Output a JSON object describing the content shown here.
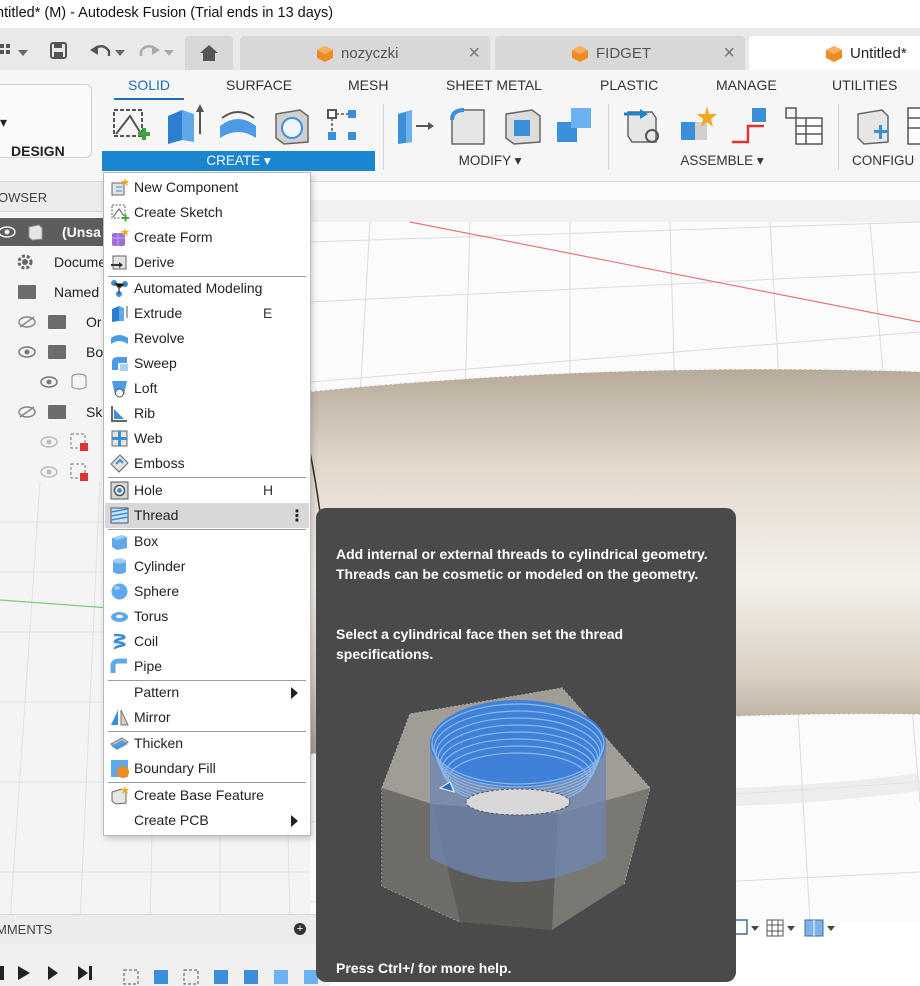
{
  "window": {
    "title": "ntitled* (M) - Autodesk Fusion (Trial ends in 13 days)"
  },
  "tabs": [
    {
      "label": "nozyczki",
      "active": false
    },
    {
      "label": "FIDGET",
      "active": false
    },
    {
      "label": "Untitled*",
      "active": true
    }
  ],
  "ribbon": {
    "workspace": "DESIGN",
    "workspace_tabs": [
      "SOLID",
      "SURFACE",
      "MESH",
      "SHEET METAL",
      "PLASTIC",
      "MANAGE",
      "UTILITIES"
    ],
    "groups": {
      "create": "CREATE ▾",
      "modify": "MODIFY ▾",
      "assemble": "ASSEMBLE ▾",
      "configure": "CONFIGU"
    }
  },
  "browser": {
    "header": "OWSER",
    "root": "(Unsa",
    "items": [
      "Docume",
      "Named",
      "Or",
      "Bo",
      "Sk"
    ]
  },
  "comments": {
    "label": "MMENTS"
  },
  "create_menu": {
    "items": [
      {
        "label": "New Component",
        "icon": "new-component-icon"
      },
      {
        "label": "Create Sketch",
        "icon": "sketch-icon"
      },
      {
        "label": "Create Form",
        "icon": "form-icon"
      },
      {
        "label": "Derive",
        "icon": "derive-icon"
      },
      {
        "label": "Automated Modeling",
        "icon": "automated-modeling-icon"
      },
      {
        "label": "Extrude",
        "icon": "extrude-icon",
        "shortcut": "E"
      },
      {
        "label": "Revolve",
        "icon": "revolve-icon"
      },
      {
        "label": "Sweep",
        "icon": "sweep-icon"
      },
      {
        "label": "Loft",
        "icon": "loft-icon"
      },
      {
        "label": "Rib",
        "icon": "rib-icon"
      },
      {
        "label": "Web",
        "icon": "web-icon"
      },
      {
        "label": "Emboss",
        "icon": "emboss-icon"
      },
      {
        "label": "Hole",
        "icon": "hole-icon",
        "shortcut": "H"
      },
      {
        "label": "Thread",
        "icon": "thread-icon",
        "highlighted": true
      },
      {
        "label": "Box",
        "icon": "box-icon"
      },
      {
        "label": "Cylinder",
        "icon": "cylinder-icon"
      },
      {
        "label": "Sphere",
        "icon": "sphere-icon"
      },
      {
        "label": "Torus",
        "icon": "torus-icon"
      },
      {
        "label": "Coil",
        "icon": "coil-icon"
      },
      {
        "label": "Pipe",
        "icon": "pipe-icon"
      },
      {
        "label": "Pattern",
        "submenu": true
      },
      {
        "label": "Mirror",
        "icon": "mirror-icon"
      },
      {
        "label": "Thicken",
        "icon": "thicken-icon"
      },
      {
        "label": "Boundary Fill",
        "icon": "boundary-fill-icon"
      },
      {
        "label": "Create Base Feature",
        "icon": "base-feature-icon"
      },
      {
        "label": "Create PCB",
        "submenu": true
      }
    ]
  },
  "tooltip": {
    "description": "Add internal or external threads to cylindrical geometry. Threads can be cosmetic or modeled on the geometry.",
    "instruction": "Select a cylindrical face then set the thread specifications.",
    "help": "Press Ctrl+/ for more help."
  },
  "colors": {
    "accent": "#1a86d0",
    "tooltip_bg": "#4a4a4a",
    "icon_blue": "#3b8fd9",
    "highlight": "#d8d8d8"
  }
}
